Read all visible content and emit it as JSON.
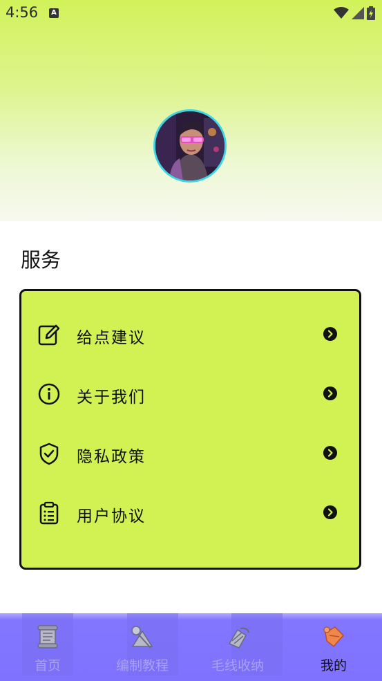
{
  "status_bar": {
    "time": "4:56",
    "notification_badge": "A",
    "icons": [
      "wifi-icon",
      "signal-icon",
      "battery-icon"
    ]
  },
  "profile": {
    "avatar_icon": "user-avatar"
  },
  "services": {
    "title": "服务",
    "items": [
      {
        "label": "给点建议",
        "icon": "edit-icon"
      },
      {
        "label": "关于我们",
        "icon": "info-icon"
      },
      {
        "label": "隐私政策",
        "icon": "shield-check-icon"
      },
      {
        "label": "用户协议",
        "icon": "clipboard-list-icon"
      }
    ]
  },
  "tabbar": {
    "tabs": [
      {
        "label": "首页",
        "icon": "scroll-icon",
        "active": false
      },
      {
        "label": "编制教程",
        "icon": "yarn-tutorial-icon",
        "active": false
      },
      {
        "label": "毛线收纳",
        "icon": "yarn-storage-icon",
        "active": false
      },
      {
        "label": "我的",
        "icon": "profile-icon",
        "active": true
      }
    ]
  },
  "colors": {
    "accent_green": "#d1f252",
    "tabbar_purple": "#7f72ff",
    "avatar_border": "#3fd6e6"
  }
}
